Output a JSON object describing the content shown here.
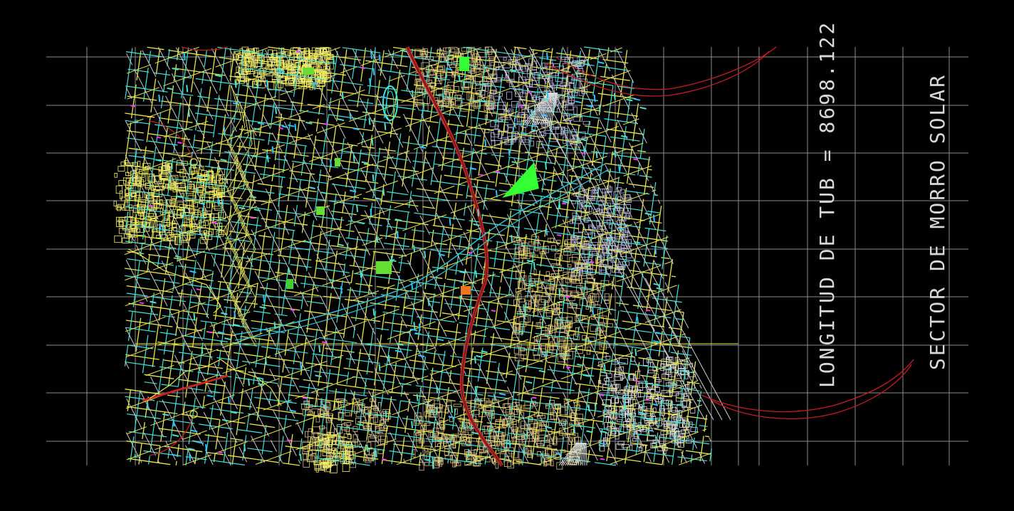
{
  "labels": {
    "longitud": "LONGITUD DE TUB = 8698.122",
    "sector": "SECTOR DE MORRO SOLAR"
  },
  "colors": {
    "background": "#000000",
    "grid": "#8c8c8c",
    "streets_yellow": "#e8e84a",
    "streets_cyan": "#3fe6d8",
    "pipes_green": "#66ff66",
    "river_cyan": "#2ec4d6",
    "highway_red": "#cc2222",
    "annotation_red": "#c41e1e",
    "park_green": "#33ff33",
    "label_text": "#d8d8d8",
    "block_white": "#e0e0e0",
    "magenta_marks": "#ff33ff"
  },
  "icons": [
    "north-arrow-icon",
    "section-marker-icon"
  ]
}
